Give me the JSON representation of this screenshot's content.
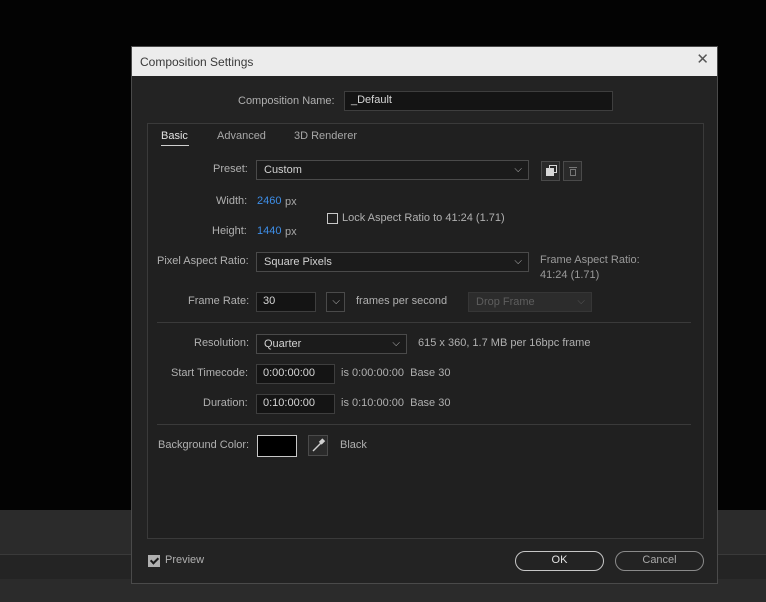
{
  "dialog": {
    "title": "Composition Settings",
    "close_icon": "close-icon"
  },
  "composition_name": {
    "label": "Composition Name:",
    "value": "_Default"
  },
  "tabs": [
    {
      "label": "Basic",
      "active": true
    },
    {
      "label": "Advanced",
      "active": false
    },
    {
      "label": "3D Renderer",
      "active": false
    }
  ],
  "preset": {
    "label": "Preset:",
    "value": "Custom",
    "save_icon": "save-preset-icon",
    "delete_icon": "trash-icon"
  },
  "width": {
    "label": "Width:",
    "value": "2460",
    "unit": "px"
  },
  "height": {
    "label": "Height:",
    "value": "1440",
    "unit": "px"
  },
  "lock_aspect": {
    "label": "Lock Aspect Ratio to 41:24 (1.71)",
    "checked": false
  },
  "pixel_aspect": {
    "label": "Pixel Aspect Ratio:",
    "value": "Square Pixels",
    "frame_aspect_label": "Frame Aspect Ratio:",
    "frame_aspect_value": "41:24 (1.71)"
  },
  "frame_rate": {
    "label": "Frame Rate:",
    "value": "30",
    "unit": "frames per second",
    "drop_frame": "Drop Frame"
  },
  "resolution": {
    "label": "Resolution:",
    "value": "Quarter",
    "info": "615 x 360, 1.7 MB per 16bpc frame"
  },
  "start_timecode": {
    "label": "Start Timecode:",
    "value": "0:00:00:00",
    "info": "is 0:00:00:00  Base 30"
  },
  "duration": {
    "label": "Duration:",
    "value": "0:10:00:00",
    "info": "is 0:10:00:00  Base 30"
  },
  "background_color": {
    "label": "Background Color:",
    "swatch": "#000000",
    "name": "Black",
    "eyedropper_icon": "eyedropper-icon"
  },
  "footer": {
    "preview_label": "Preview",
    "preview_checked": true,
    "ok_label": "OK",
    "cancel_label": "Cancel"
  },
  "colors": {
    "accent": "#3d8ee8",
    "dialog_bg": "#232323"
  }
}
